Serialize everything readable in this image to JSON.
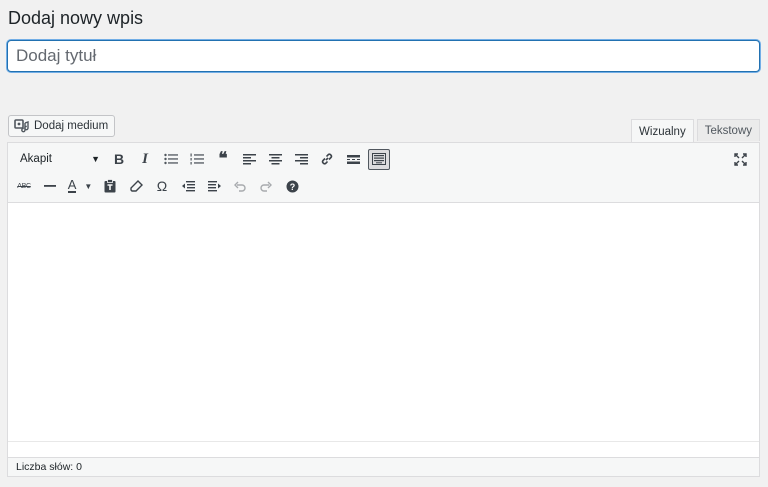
{
  "page": {
    "heading": "Dodaj nowy wpis"
  },
  "title_field": {
    "placeholder": "Dodaj tytuł",
    "value": ""
  },
  "media": {
    "add_media_label": "Dodaj medium"
  },
  "tabs": {
    "visual": "Wizualny",
    "text": "Tekstowy",
    "active": "visual"
  },
  "toolbar": {
    "format_select": "Akapit",
    "row1_icons": [
      "bold-icon",
      "italic-icon",
      "bulleted-list-icon",
      "numbered-list-icon",
      "blockquote-icon",
      "align-left-icon",
      "align-center-icon",
      "align-right-icon",
      "link-icon",
      "read-more-icon",
      "toolbar-toggle-icon"
    ],
    "row2_icons": [
      "strikethrough-icon",
      "horizontal-line-icon",
      "text-color-icon",
      "paste-as-text-icon",
      "clear-formatting-icon",
      "special-character-icon",
      "outdent-icon",
      "indent-icon",
      "undo-icon",
      "redo-icon",
      "help-icon"
    ],
    "fullscreen_icon": "fullscreen-icon"
  },
  "status": {
    "word_count": "Liczba słów: 0"
  },
  "colors": {
    "focus_border": "#2271b1",
    "background": "#f1f1f1",
    "toolbar_bg": "#f6f7f7"
  }
}
